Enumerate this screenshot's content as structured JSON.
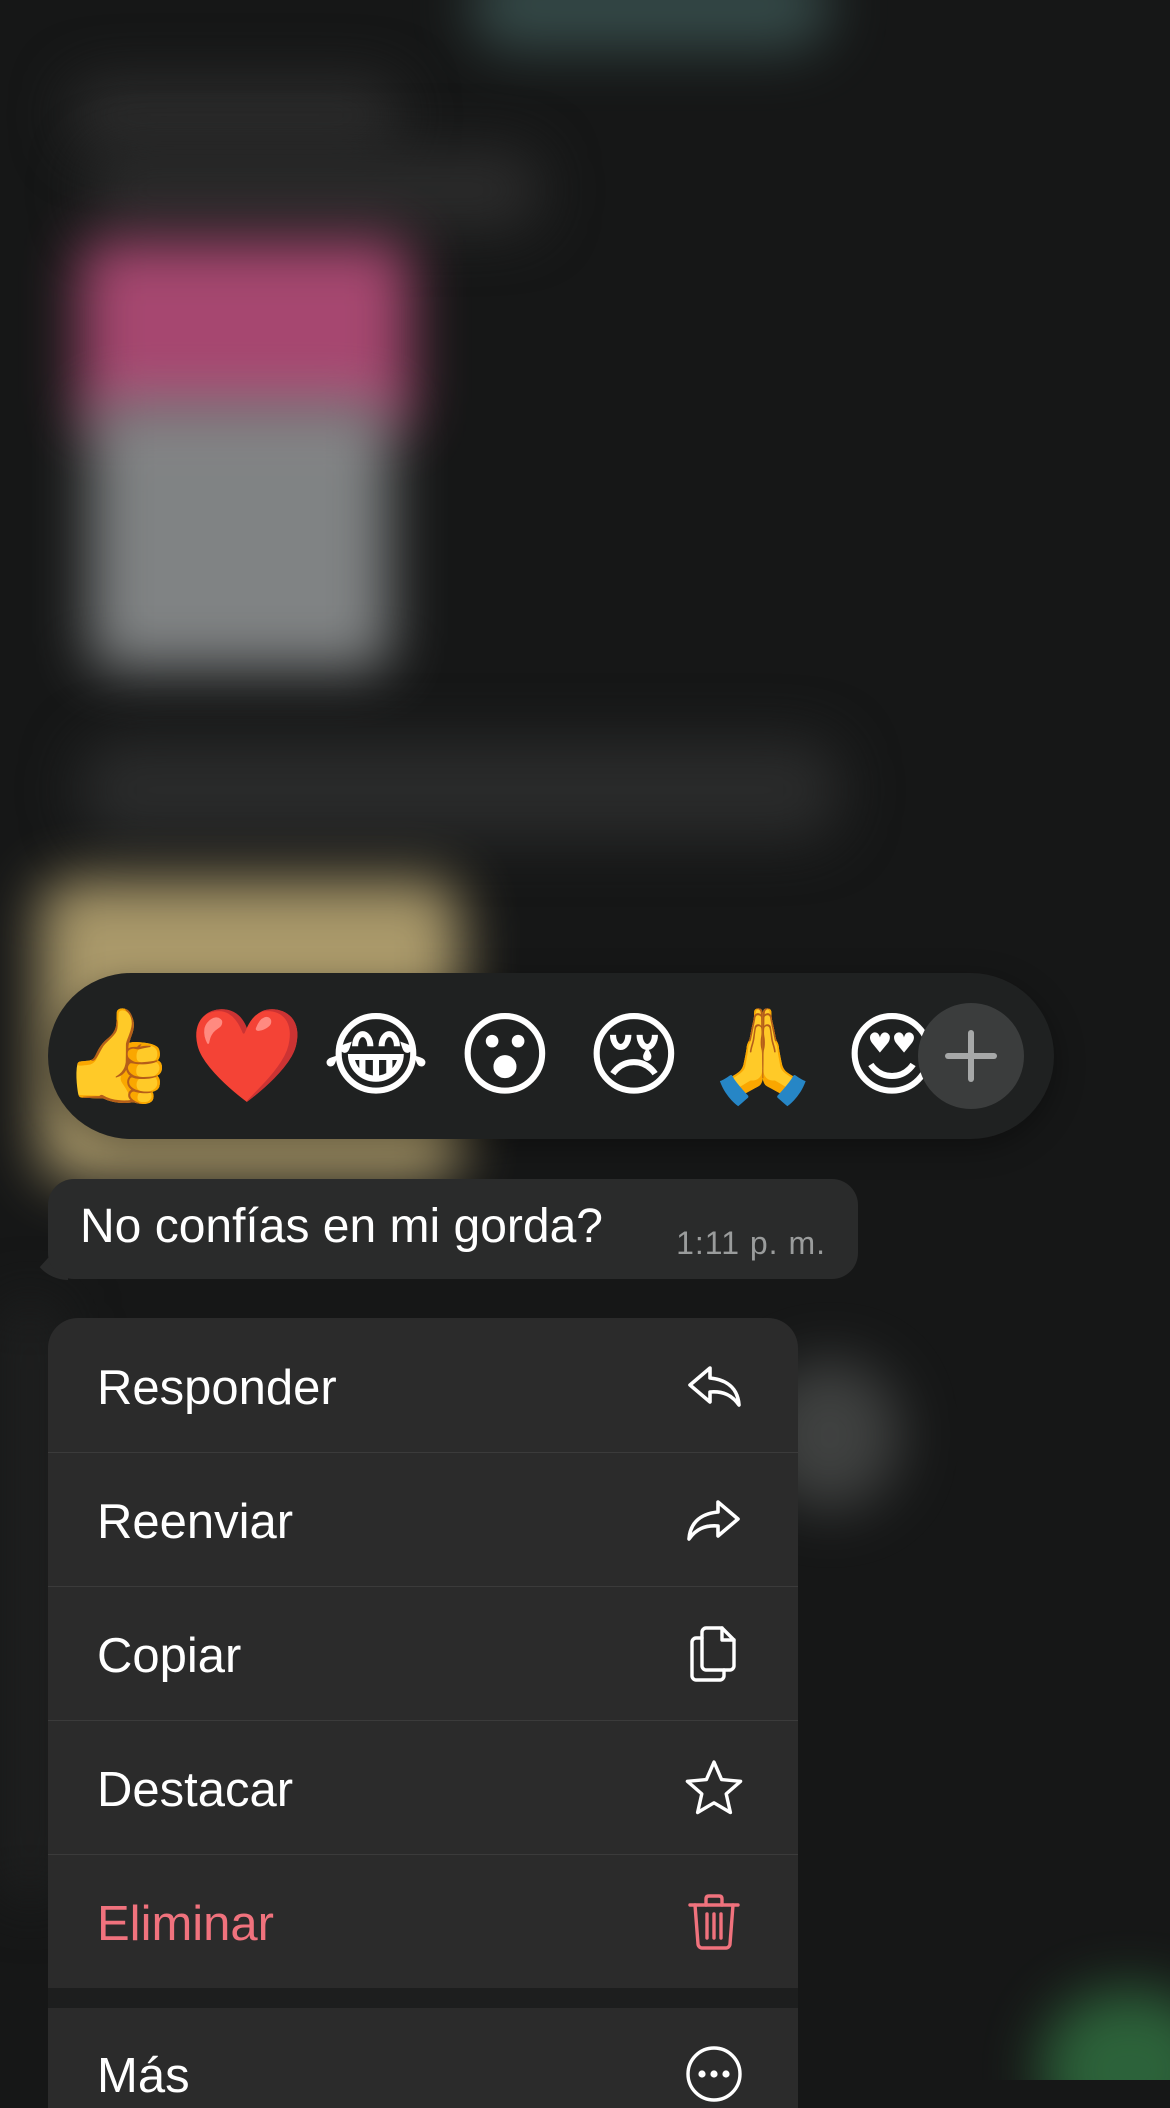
{
  "reactions": {
    "emojis": [
      "👍",
      "❤️",
      "😂",
      "😮",
      "😢",
      "🙏",
      "😍"
    ],
    "emoji_names": [
      "thumbs-up",
      "red-heart",
      "face-with-tears-of-joy",
      "face-with-open-mouth",
      "crying-face",
      "folded-hands",
      "smiling-face-with-heart-eyes"
    ],
    "more_icon": "plus-icon"
  },
  "message": {
    "text": "No confías en mi gorda?",
    "time": "1:11 p. m."
  },
  "menu": {
    "items": [
      {
        "label": "Responder",
        "icon": "reply-icon"
      },
      {
        "label": "Reenviar",
        "icon": "forward-icon"
      },
      {
        "label": "Copiar",
        "icon": "copy-icon"
      },
      {
        "label": "Destacar",
        "icon": "star-icon"
      },
      {
        "label": "Eliminar",
        "icon": "trash-icon",
        "color": "#f0727d"
      }
    ],
    "more": {
      "label": "Más",
      "icon": "more-icon"
    }
  },
  "colors": {
    "background": "#161717",
    "menu_bg": "#2b2b2b",
    "bubble_bg": "#2a2b2b",
    "danger": "#f0727d"
  }
}
